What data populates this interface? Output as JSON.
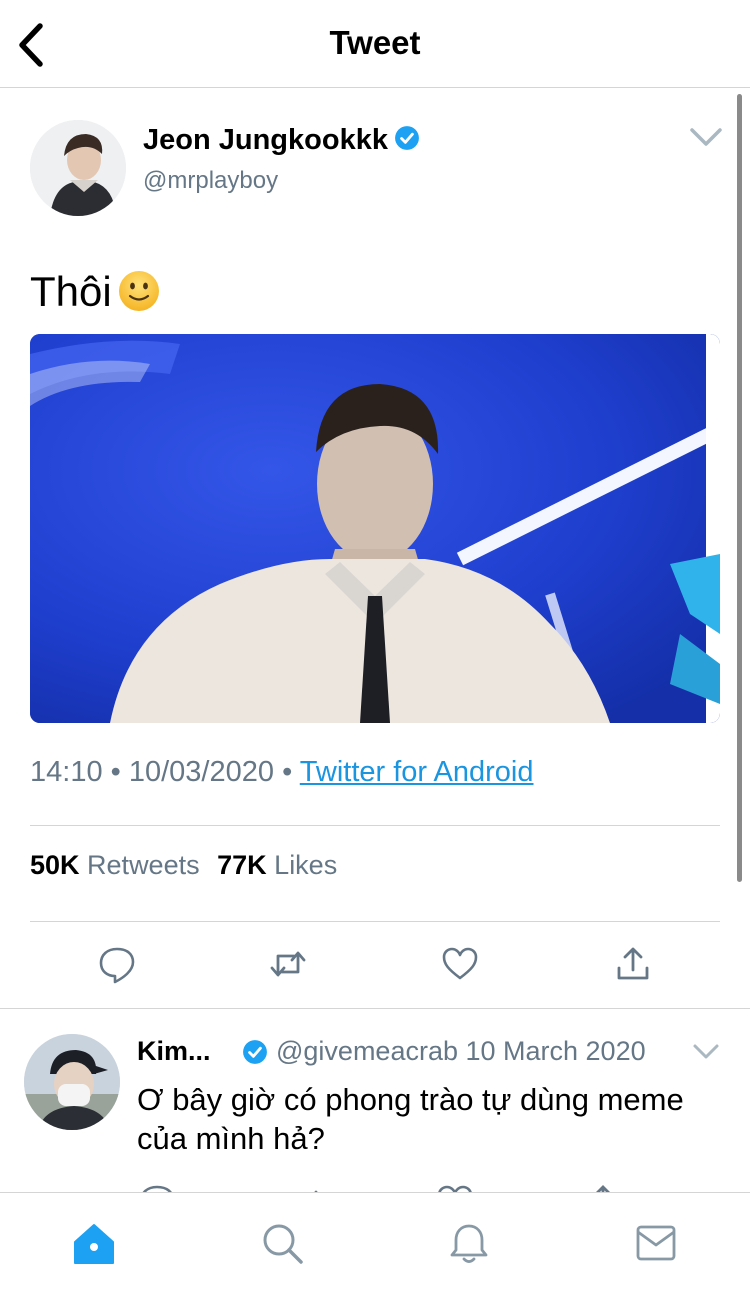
{
  "header": {
    "title": "Tweet",
    "back_icon": "chevron-left-icon"
  },
  "tweet": {
    "author_name": "Jeon Jungkookkk",
    "author_handle": "@mrplayboy",
    "verified": true,
    "text": "Thôi",
    "emoji": "slightly-smiling-face",
    "time": "14:10",
    "date": "10/03/2020",
    "separator": "•",
    "source": "Twitter for Android",
    "retweets_count": "50K",
    "retweets_label": "Retweets",
    "likes_count": "77K",
    "likes_label": "Likes"
  },
  "reply": {
    "author_name": "Kim...",
    "verified": true,
    "handle_date": "@givemeacrab 10 March 2020",
    "text": "Ơ bây giờ có phong trào tự dùng meme của mình hả?"
  },
  "actions": [
    "reply-icon",
    "retweet-icon",
    "like-icon",
    "share-icon"
  ],
  "tabs": [
    "home-icon",
    "search-icon",
    "notifications-icon",
    "messages-icon"
  ],
  "colors": {
    "accent": "#1b95e0",
    "secondary_text": "#657786",
    "tab_active": "#1da1f2",
    "tab_inactive": "#8899a6"
  }
}
